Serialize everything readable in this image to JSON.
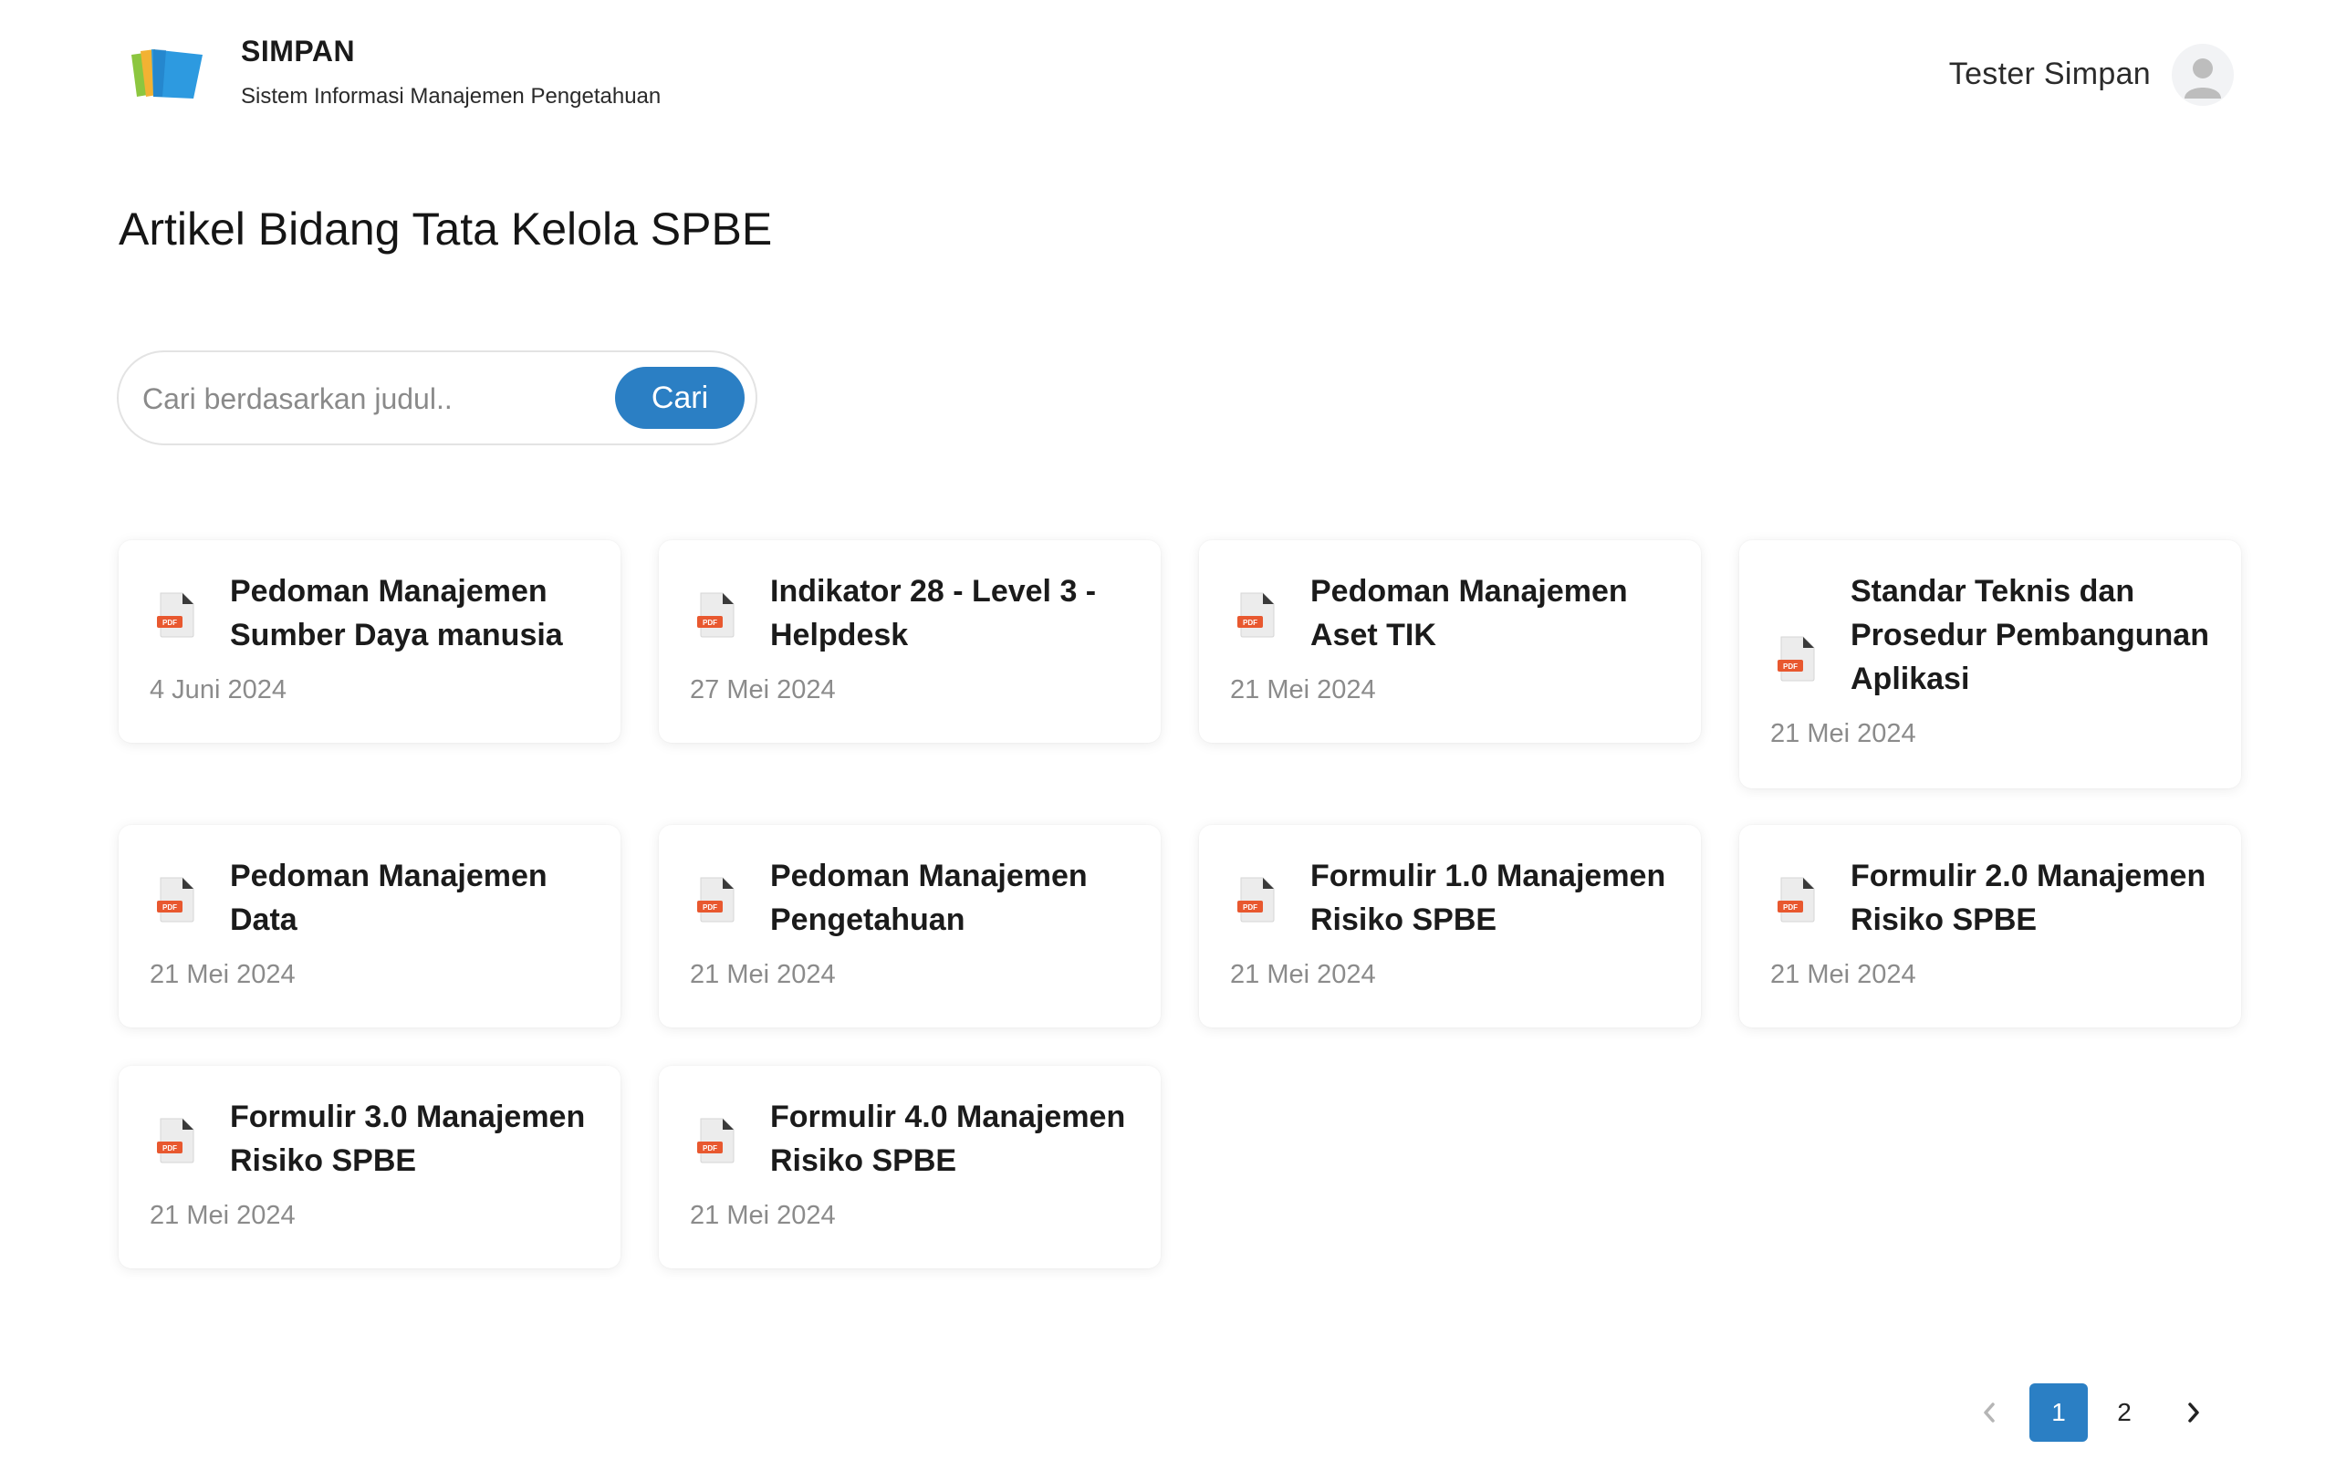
{
  "header": {
    "brand_title": "SIMPAN",
    "brand_subtitle": "Sistem Informasi Manajemen Pengetahuan",
    "user_name": "Tester Simpan"
  },
  "main": {
    "page_title": "Artikel Bidang Tata Kelola SPBE",
    "search": {
      "placeholder": "Cari berdasarkan judul..",
      "value": "",
      "button_label": "Cari"
    },
    "articles": [
      {
        "title": "Pedoman Manajemen Sumber Daya manusia",
        "date": "4 Juni 2024",
        "icon": "pdf-file-icon"
      },
      {
        "title": "Indikator 28 - Level 3 - Helpdesk",
        "date": "27 Mei 2024",
        "icon": "pdf-file-icon"
      },
      {
        "title": "Pedoman Manajemen Aset TIK",
        "date": "21 Mei 2024",
        "icon": "pdf-file-icon"
      },
      {
        "title": "Standar Teknis dan Prosedur Pembangunan Aplikasi",
        "date": "21 Mei 2024",
        "icon": "pdf-file-icon"
      },
      {
        "title": "Pedoman Manajemen Data",
        "date": "21 Mei 2024",
        "icon": "pdf-file-icon"
      },
      {
        "title": "Pedoman Manajemen Pengetahuan",
        "date": "21 Mei 2024",
        "icon": "pdf-file-icon"
      },
      {
        "title": "Formulir 1.0 Manajemen Risiko SPBE",
        "date": "21 Mei 2024",
        "icon": "pdf-file-icon"
      },
      {
        "title": "Formulir 2.0 Manajemen Risiko SPBE",
        "date": "21 Mei 2024",
        "icon": "pdf-file-icon"
      },
      {
        "title": "Formulir 3.0 Manajemen Risiko SPBE",
        "date": "21 Mei 2024",
        "icon": "pdf-file-icon"
      },
      {
        "title": "Formulir 4.0 Manajemen Risiko SPBE",
        "date": "21 Mei 2024",
        "icon": "pdf-file-icon"
      }
    ],
    "pdf_icon_label": "PDF"
  },
  "pagination": {
    "pages": [
      "1",
      "2"
    ],
    "current": "1"
  },
  "colors": {
    "accent": "#2b7fc4",
    "pdf_badge": "#e8582f",
    "date_text": "#8b8b8b"
  }
}
